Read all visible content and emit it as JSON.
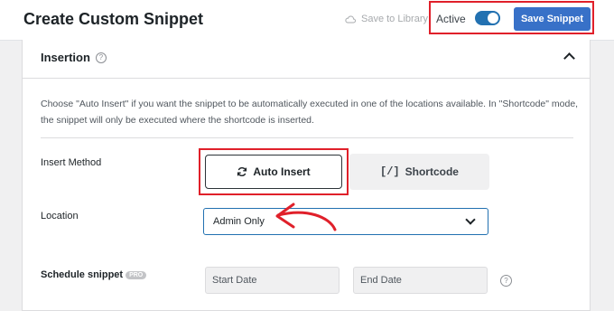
{
  "header": {
    "title": "Create Custom Snippet",
    "save_to_library": "Save to Library",
    "active_label": "Active",
    "active_toggle": true,
    "save_button": "Save Snippet"
  },
  "insertion": {
    "section_title": "Insertion",
    "description": "Choose \"Auto Insert\" if you want the snippet to be automatically executed in one of the locations available. In \"Shortcode\" mode, the snippet will only be executed where the shortcode is inserted.",
    "insert_method_label": "Insert Method",
    "auto_insert_label": "Auto Insert",
    "shortcode_label": "Shortcode",
    "location_label": "Location",
    "location_value": "Admin Only",
    "schedule_label": "Schedule snippet",
    "pro_badge": "PRO",
    "start_date_placeholder": "Start Date",
    "end_date_placeholder": "End Date"
  },
  "colors": {
    "accent": "#3871c8",
    "highlight": "#e0202a"
  }
}
